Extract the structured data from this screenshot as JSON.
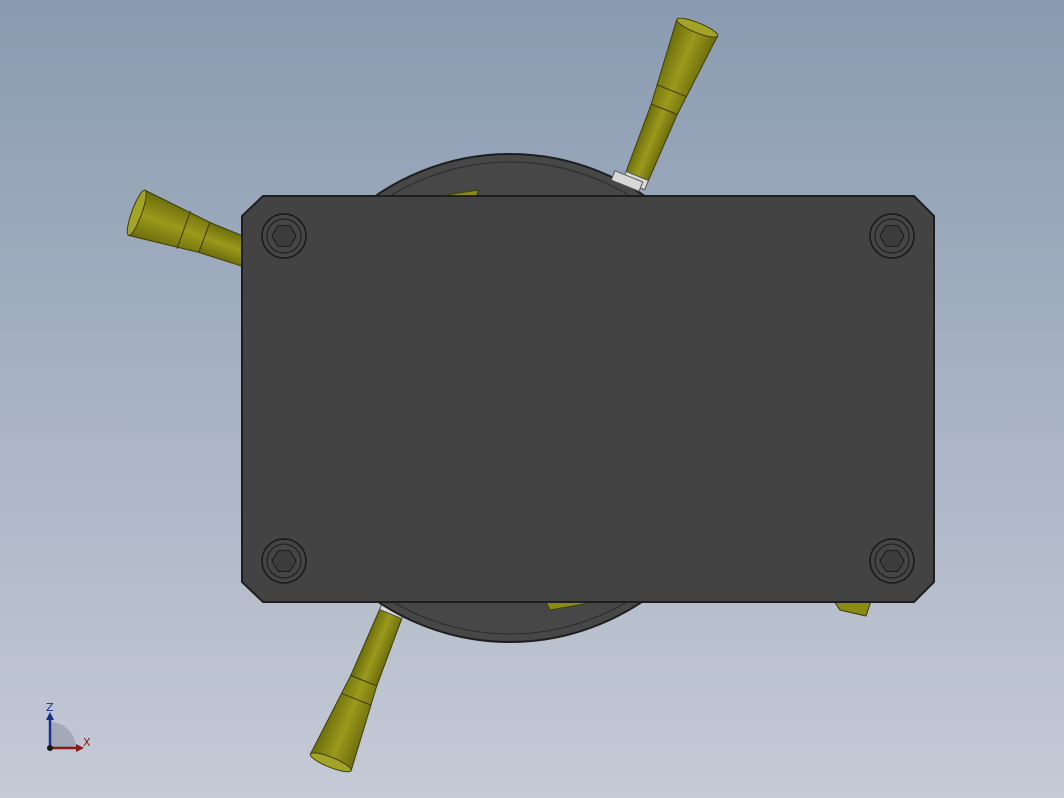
{
  "viewport": {
    "background_top": "#8a9bb1",
    "background_bottom": "#c5cad6"
  },
  "model": {
    "plate_color": "#434343",
    "plate_edge_color": "#1e1e1e",
    "disc_color": "#474747",
    "handle_color": "#8a8a14",
    "handle_shade_color": "#6b6b0c",
    "screw_color": "#454545"
  },
  "triad": {
    "z_label": "Z",
    "x_label": "X",
    "z_color": "#1a2f8a",
    "x_color": "#8a1a1a"
  }
}
